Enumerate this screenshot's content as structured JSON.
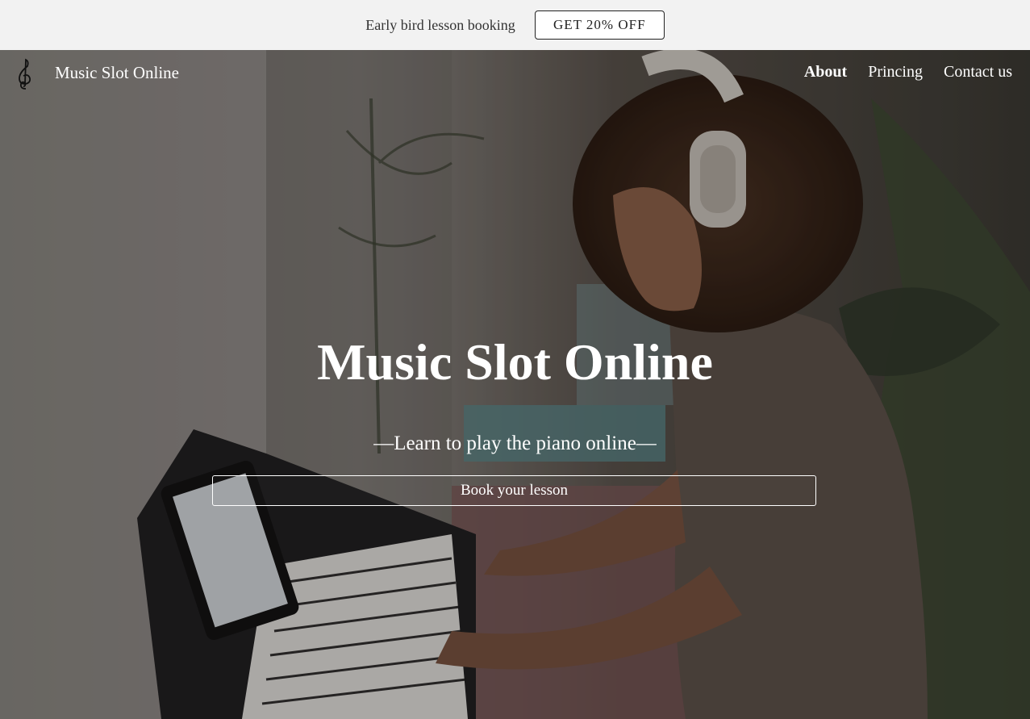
{
  "promo": {
    "text": "Early bird lesson booking",
    "button_label": "GET 20% OFF"
  },
  "nav": {
    "logo_icon": "treble-clef-icon",
    "brand": "Music Slot Online",
    "links": [
      {
        "label": "About",
        "active": true
      },
      {
        "label": "Princing",
        "active": false
      },
      {
        "label": "Contact us",
        "active": false
      }
    ]
  },
  "hero": {
    "title": "Music Slot Online",
    "subtitle": "—Learn to play the piano online—",
    "cta_label": "Book your lesson"
  },
  "colors": {
    "promo_bg": "#f2f2f2",
    "hero_text": "#ffffff"
  }
}
